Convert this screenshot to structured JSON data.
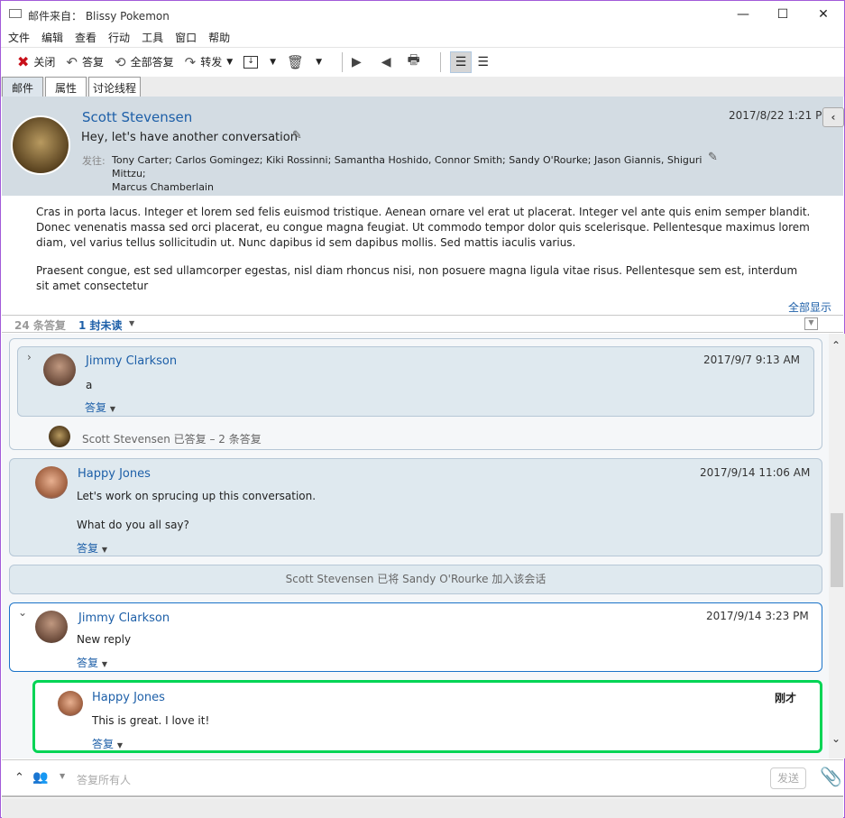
{
  "window": {
    "title": "邮件来自： Blissy Pokemon",
    "minimize": "—",
    "maximize": "☐",
    "close": "✕"
  },
  "menu": [
    "文件",
    "编辑",
    "查看",
    "行动",
    "工具",
    "窗口",
    "帮助"
  ],
  "toolbar": {
    "close": "关闭",
    "reply": "答复",
    "reply_all": "全部答复",
    "forward": "转发"
  },
  "tabs": [
    "邮件",
    "属性",
    "讨论线程"
  ],
  "message": {
    "sender": "Scott Stevensen",
    "subject": "Hey, let's have another conversation",
    "date": "2017/8/22 1:21 PM",
    "to_label": "发往:",
    "to": "Tony Carter; Carlos Gomingez; Kiki Rossinni; Samantha Hoshido, Connor Smith; Sandy O'Rourke; Jason Giannis, Shiguri Mittzu;",
    "to_cont": "Marcus Chamberlain",
    "body1": "Cras in porta lacus. Integer et lorem sed felis euismod tristique. Aenean ornare vel erat ut placerat. Integer vel ante quis enim semper blandit. Donec venenatis massa sed orci placerat, eu congue magna feugiat. Ut commodo tempor dolor quis scelerisque. Pellentesque maximus lorem diam, vel varius tellus sollicitudin ut. Nunc dapibus id sem dapibus mollis. Sed mattis iaculis varius.",
    "body2": "Praesent congue, est sed ullamcorper egestas, nisl diam rhoncus nisi, non posuere magna ligula vitae risus. Pellentesque sem est, interdum sit amet consectetur",
    "show_all": "全部显示"
  },
  "thread": {
    "count": "24 条答复",
    "unread": "1 封未读"
  },
  "replies": [
    {
      "name": "Jimmy Clarkson",
      "date": "2017/9/7 9:13 AM",
      "text": "a",
      "reply": "答复",
      "summary": "Scott Stevensen 已答复 – 2 条答复"
    },
    {
      "name": "Happy Jones",
      "date": "2017/9/14 11:06 AM",
      "text": "Let's work on sprucing up this conversation.",
      "text2": "What do you all say?",
      "reply": "答复"
    },
    {
      "system": "Scott Stevensen 已将 Sandy O'Rourke 加入该会话"
    },
    {
      "name": "Jimmy Clarkson",
      "date": "2017/9/14 3:23 PM",
      "text": "New reply",
      "reply": "答复"
    },
    {
      "name": "Happy Jones",
      "date": "刚才",
      "text": "This is great. I love it!",
      "reply": "答复"
    }
  ],
  "compose": {
    "placeholder": "答复所有人",
    "send": "发送"
  },
  "colors": {
    "accent": "#1d5fa8",
    "header_bg": "#d3dce3",
    "card_bg": "#dfe9ef",
    "selected_border": "#00d455",
    "focus_border": "#1a73c8"
  }
}
